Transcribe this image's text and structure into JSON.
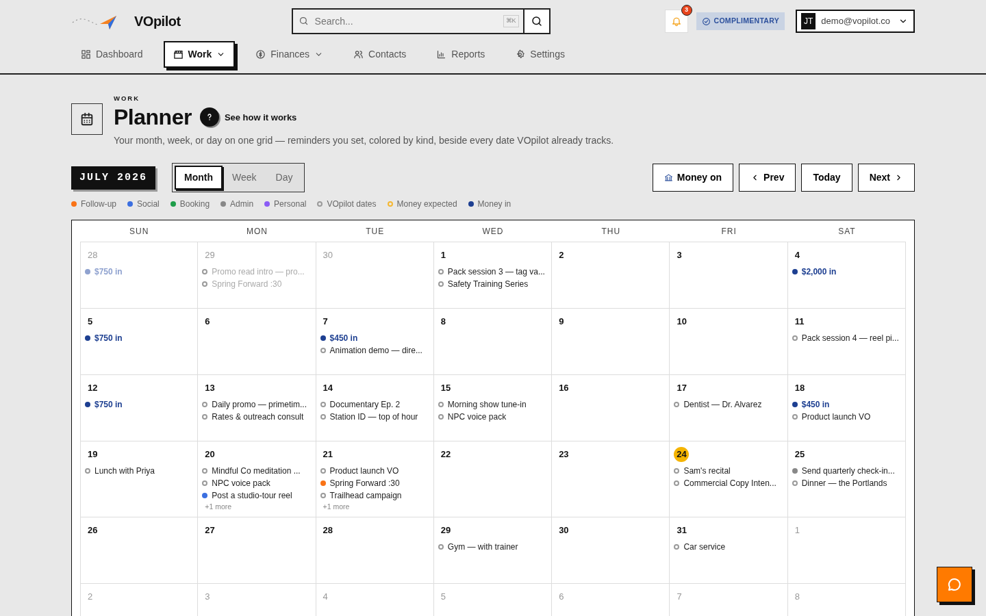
{
  "header": {
    "logo_text": "VOpilot",
    "search": {
      "placeholder": "Search...",
      "shortcut": "⌘K"
    },
    "notifications": {
      "count": "3"
    },
    "plan_badge": "COMPLIMENTARY",
    "user": {
      "initials": "JT",
      "email": "demo@vopilot.co"
    }
  },
  "nav": [
    {
      "label": "Dashboard",
      "selected": false,
      "dropdown": false
    },
    {
      "label": "Work",
      "selected": true,
      "dropdown": true
    },
    {
      "label": "Finances",
      "selected": false,
      "dropdown": true
    },
    {
      "label": "Contacts",
      "selected": false,
      "dropdown": false
    },
    {
      "label": "Reports",
      "selected": false,
      "dropdown": false
    },
    {
      "label": "Settings",
      "selected": false,
      "dropdown": false
    }
  ],
  "page": {
    "eyebrow": "WORK",
    "title": "Planner",
    "help_label": "See how it works",
    "description": "Your month, week, or day on one grid — reminders you set, colored by kind, beside every date VOpilot already tracks."
  },
  "calendar": {
    "month_label": "JULY 2026",
    "views": [
      {
        "label": "Month",
        "selected": true
      },
      {
        "label": "Week",
        "selected": false
      },
      {
        "label": "Day",
        "selected": false
      }
    ],
    "actions": [
      "Money on",
      "Prev",
      "Today",
      "Next"
    ],
    "legend": [
      {
        "label": "Follow-up",
        "color": "#f97316",
        "kind": "filled"
      },
      {
        "label": "Social",
        "color": "#3b6fe0",
        "kind": "filled"
      },
      {
        "label": "Booking",
        "color": "#1e9e4a",
        "kind": "filled"
      },
      {
        "label": "Admin",
        "color": "#888888",
        "kind": "filled"
      },
      {
        "label": "Personal",
        "color": "#8b5cf6",
        "kind": "filled"
      },
      {
        "label": "VOpilot dates",
        "color": "#9a9a9a",
        "kind": "hollow"
      },
      {
        "label": "Money expected",
        "color": "#f5b731",
        "kind": "hollow"
      },
      {
        "label": "Money in",
        "color": "#1d3f91",
        "kind": "filled"
      }
    ],
    "weekdays": [
      "SUN",
      "MON",
      "TUE",
      "WED",
      "THU",
      "FRI",
      "SAT"
    ],
    "weeks": [
      [
        {
          "day": "28",
          "muted": true,
          "today": false,
          "events": [
            {
              "text": "$750 in",
              "color": "#8fa2cf",
              "kind": "money"
            }
          ]
        },
        {
          "day": "29",
          "muted": true,
          "today": false,
          "events": [
            {
              "text": "Promo read intro — pro...",
              "color": "#9a9a9a",
              "kind": "hollow"
            },
            {
              "text": "Spring Forward :30",
              "color": "#9a9a9a",
              "kind": "hollow"
            }
          ]
        },
        {
          "day": "30",
          "muted": true,
          "today": false
        },
        {
          "day": "1",
          "muted": false,
          "today": false,
          "events": [
            {
              "text": "Pack session 3 — tag va...",
              "color": "#9a9a9a",
              "kind": "hollow"
            },
            {
              "text": "Safety Training Series",
              "color": "#9a9a9a",
              "kind": "hollow"
            }
          ]
        },
        {
          "day": "2",
          "muted": false,
          "today": false
        },
        {
          "day": "3",
          "muted": false,
          "today": false
        },
        {
          "day": "4",
          "muted": false,
          "today": false,
          "events": [
            {
              "text": "$2,000 in",
              "color": "#1d3f91",
              "kind": "money"
            }
          ]
        }
      ],
      [
        {
          "day": "5",
          "muted": false,
          "today": false,
          "events": [
            {
              "text": "$750 in",
              "color": "#1d3f91",
              "kind": "money"
            }
          ]
        },
        {
          "day": "6",
          "muted": false,
          "today": false
        },
        {
          "day": "7",
          "muted": false,
          "today": false,
          "events": [
            {
              "text": "$450 in",
              "color": "#1d3f91",
              "kind": "money"
            },
            {
              "text": "Animation demo — dire...",
              "color": "#9a9a9a",
              "kind": "hollow"
            }
          ]
        },
        {
          "day": "8",
          "muted": false,
          "today": false
        },
        {
          "day": "9",
          "muted": false,
          "today": false
        },
        {
          "day": "10",
          "muted": false,
          "today": false
        },
        {
          "day": "11",
          "muted": false,
          "today": false,
          "events": [
            {
              "text": "Pack session 4 — reel pi...",
              "color": "#9a9a9a",
              "kind": "hollow"
            }
          ]
        }
      ],
      [
        {
          "day": "12",
          "muted": false,
          "today": false,
          "events": [
            {
              "text": "$750 in",
              "color": "#1d3f91",
              "kind": "money"
            }
          ]
        },
        {
          "day": "13",
          "muted": false,
          "today": false,
          "events": [
            {
              "text": "Daily promo — primetim...",
              "color": "#9a9a9a",
              "kind": "hollow"
            },
            {
              "text": "Rates & outreach consult",
              "color": "#9a9a9a",
              "kind": "hollow"
            }
          ]
        },
        {
          "day": "14",
          "muted": false,
          "today": false,
          "events": [
            {
              "text": "Documentary Ep. 2",
              "color": "#9a9a9a",
              "kind": "hollow"
            },
            {
              "text": "Station ID — top of hour",
              "color": "#9a9a9a",
              "kind": "hollow"
            }
          ]
        },
        {
          "day": "15",
          "muted": false,
          "today": false,
          "events": [
            {
              "text": "Morning show tune-in",
              "color": "#9a9a9a",
              "kind": "hollow"
            },
            {
              "text": "NPC voice pack",
              "color": "#9a9a9a",
              "kind": "hollow"
            }
          ]
        },
        {
          "day": "16",
          "muted": false,
          "today": false
        },
        {
          "day": "17",
          "muted": false,
          "today": false,
          "events": [
            {
              "text": "Dentist — Dr. Alvarez",
              "color": "#9a9a9a",
              "kind": "hollow"
            }
          ]
        },
        {
          "day": "18",
          "muted": false,
          "today": false,
          "events": [
            {
              "text": "$450 in",
              "color": "#1d3f91",
              "kind": "money"
            },
            {
              "text": "Product launch VO",
              "color": "#9a9a9a",
              "kind": "hollow"
            }
          ]
        }
      ],
      [
        {
          "day": "19",
          "muted": false,
          "today": false,
          "events": [
            {
              "text": "Lunch with Priya",
              "color": "#9a9a9a",
              "kind": "hollow"
            }
          ]
        },
        {
          "day": "20",
          "muted": false,
          "today": false,
          "events": [
            {
              "text": "Mindful Co meditation ...",
              "color": "#9a9a9a",
              "kind": "hollow"
            },
            {
              "text": "NPC voice pack",
              "color": "#9a9a9a",
              "kind": "hollow"
            },
            {
              "text": "Post a studio-tour reel",
              "color": "#3b6fe0",
              "kind": "filled"
            }
          ],
          "more": "+1 more"
        },
        {
          "day": "21",
          "muted": false,
          "today": false,
          "events": [
            {
              "text": "Product launch VO",
              "color": "#9a9a9a",
              "kind": "hollow"
            },
            {
              "text": "Spring Forward :30",
              "color": "#f97316",
              "kind": "filled"
            },
            {
              "text": "Trailhead campaign",
              "color": "#9a9a9a",
              "kind": "hollow"
            }
          ],
          "more": "+1 more"
        },
        {
          "day": "22",
          "muted": false,
          "today": false
        },
        {
          "day": "23",
          "muted": false,
          "today": false
        },
        {
          "day": "24",
          "muted": false,
          "today": true,
          "events": [
            {
              "text": "Sam's recital",
              "color": "#9a9a9a",
              "kind": "hollow"
            },
            {
              "text": "Commercial Copy Inten...",
              "color": "#9a9a9a",
              "kind": "hollow"
            }
          ]
        },
        {
          "day": "25",
          "muted": false,
          "today": false,
          "events": [
            {
              "text": "Send quarterly check-in...",
              "color": "#888888",
              "kind": "filled"
            },
            {
              "text": "Dinner — the Portlands",
              "color": "#9a9a9a",
              "kind": "hollow"
            }
          ]
        }
      ],
      [
        {
          "day": "26",
          "muted": false,
          "today": false
        },
        {
          "day": "27",
          "muted": false,
          "today": false
        },
        {
          "day": "28",
          "muted": false,
          "today": false
        },
        {
          "day": "29",
          "muted": false,
          "today": false,
          "events": [
            {
              "text": "Gym — with trainer",
              "color": "#9a9a9a",
              "kind": "hollow"
            }
          ]
        },
        {
          "day": "30",
          "muted": false,
          "today": false
        },
        {
          "day": "31",
          "muted": false,
          "today": false,
          "events": [
            {
              "text": "Car service",
              "color": "#9a9a9a",
              "kind": "hollow"
            }
          ]
        },
        {
          "day": "1",
          "muted": true,
          "today": false
        }
      ],
      [
        {
          "day": "2",
          "muted": true,
          "today": false
        },
        {
          "day": "3",
          "muted": true,
          "today": false
        },
        {
          "day": "4",
          "muted": true,
          "today": false
        },
        {
          "day": "5",
          "muted": true,
          "today": false
        },
        {
          "day": "6",
          "muted": true,
          "today": false
        },
        {
          "day": "7",
          "muted": true,
          "today": false
        },
        {
          "day": "8",
          "muted": true,
          "today": false
        }
      ]
    ]
  }
}
